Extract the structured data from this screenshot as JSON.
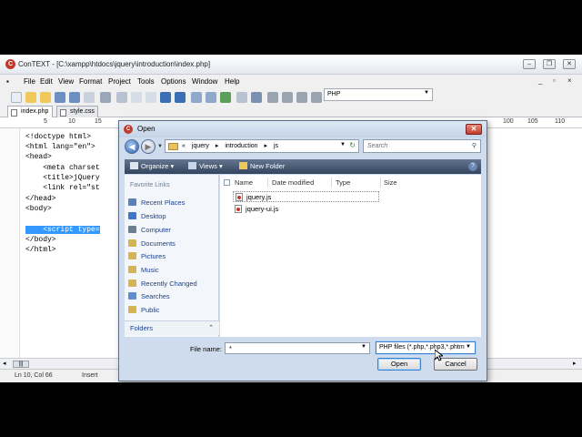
{
  "app": {
    "title": "ConTEXT - [C:\\xampp\\htdocs\\jquery\\introduction\\index.php]",
    "icon_letter": "C",
    "window_controls": [
      "minimize",
      "restore",
      "close"
    ]
  },
  "menu": {
    "items": [
      "File",
      "Edit",
      "View",
      "Format",
      "Project",
      "Tools",
      "Options",
      "Window",
      "Help"
    ]
  },
  "toolbar": {
    "language": "PHP"
  },
  "tabs": [
    {
      "label": "index.php",
      "active": true
    },
    {
      "label": "style.css",
      "active": false
    }
  ],
  "ruler": {
    "left_labels": [
      "5",
      "10",
      "15"
    ],
    "right_labels": [
      "100",
      "105",
      "110"
    ]
  },
  "editor": {
    "lines": [
      "<!doctype html>",
      "<html lang=\"en\">",
      "<head>",
      "    <meta charset",
      "    <title>jQuery",
      "    <link rel=\"st",
      "</head>",
      "<body>",
      "",
      "    <script type=",
      "</body>",
      "</html>"
    ],
    "selected_line_index": 9
  },
  "status": {
    "position": "Ln 10, Col 66",
    "mode": "Insert"
  },
  "dialog": {
    "title": "Open",
    "breadcrumb": [
      "«",
      "jquery",
      "▸",
      "introduction",
      "▸",
      "js"
    ],
    "search_placeholder": "Search",
    "commands": {
      "organize": "Organize ▾",
      "views": "Views ▾",
      "new_folder": "New Folder"
    },
    "favorite_links_heading": "Favorite Links",
    "favorite_links": [
      {
        "label": "Recent Places",
        "color": "#5b7fb8"
      },
      {
        "label": "Desktop",
        "color": "#3d78c9"
      },
      {
        "label": "Computer",
        "color": "#6f7f91"
      },
      {
        "label": "Documents",
        "color": "#d6b453"
      },
      {
        "label": "Pictures",
        "color": "#d6b453"
      },
      {
        "label": "Music",
        "color": "#d6b453"
      },
      {
        "label": "Recently Changed",
        "color": "#d6b453"
      },
      {
        "label": "Searches",
        "color": "#5b8fd1"
      },
      {
        "label": "Public",
        "color": "#d6b453"
      }
    ],
    "folders_label": "Folders",
    "columns": [
      "Name",
      "Date modified",
      "Type",
      "Size"
    ],
    "files": [
      "jquery.js",
      "jquery-ui.js"
    ],
    "file_name_label": "File name:",
    "file_name_value": "*",
    "filter": "PHP files (*.php,*.php3,*.phtm",
    "open_label": "Open",
    "cancel_label": "Cancel"
  }
}
